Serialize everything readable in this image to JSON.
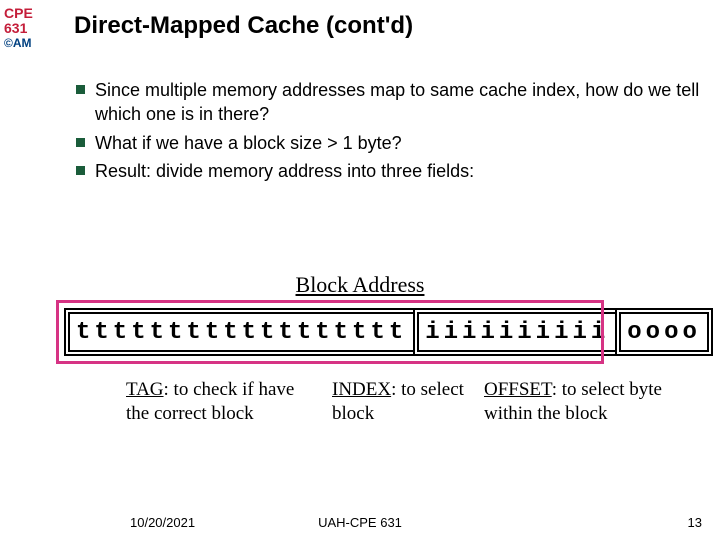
{
  "course": {
    "line1": "CPE",
    "line2": "631",
    "line3": "©AM"
  },
  "title": "Direct-Mapped Cache (cont'd)",
  "bullets": [
    "Since multiple memory addresses map to same cache index, how do we tell which one is in there?",
    "What if we have a block size > 1 byte?",
    "Result: divide memory address into three fields:"
  ],
  "block_address_label": "Block Address",
  "fields": {
    "tag": "tttttttttttttttttt",
    "index": "iiiiiiiiii",
    "offset": "oooo"
  },
  "field_labels": {
    "tag_head": "TAG",
    "tag_rest": ": to check if have the correct block",
    "index_head": "INDEX",
    "index_rest": ": to select block",
    "offset_head": "OFFSET",
    "offset_rest": ": to select byte within the block"
  },
  "footer": {
    "date": "10/20/2021",
    "center": "UAH-CPE 631",
    "page": "13"
  }
}
